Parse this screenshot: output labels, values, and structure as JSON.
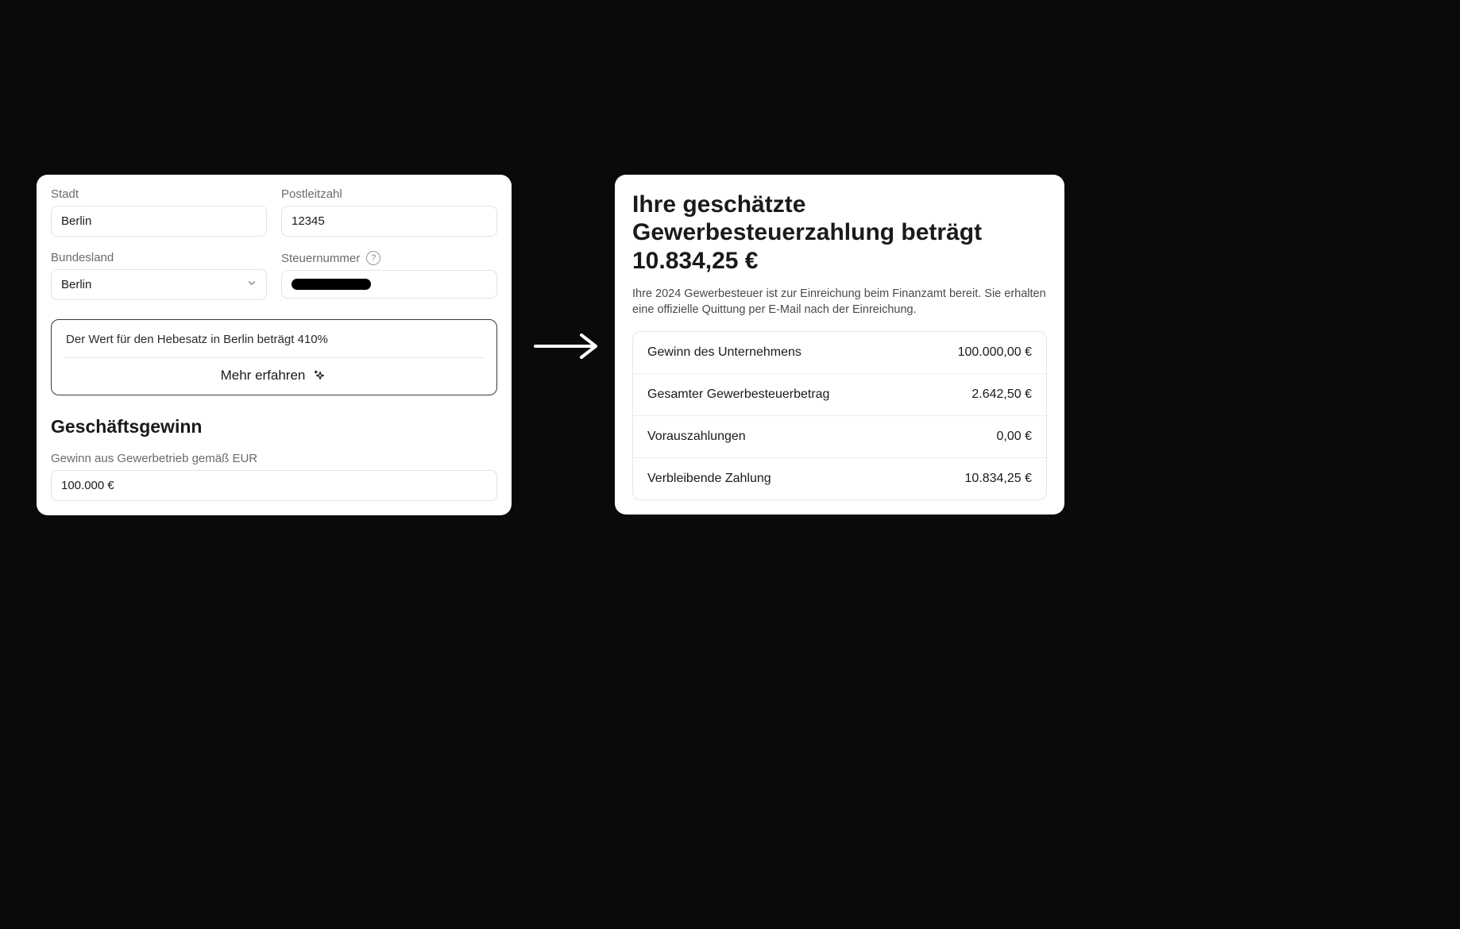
{
  "form": {
    "city": {
      "label": "Stadt",
      "value": "Berlin"
    },
    "postal": {
      "label": "Postleitzahl",
      "value": "12345"
    },
    "state": {
      "label": "Bundesland",
      "value": "Berlin"
    },
    "taxnum": {
      "label": "Steuernummer",
      "value": ""
    },
    "info": {
      "text": "Der Wert für den Hebesatz in Berlin beträgt 410%",
      "learn_more": "Mehr erfahren"
    },
    "profit": {
      "section_title": "Geschäftsgewinn",
      "label": "Gewinn aus Gewerbetrieb gemäß EUR",
      "value": "100.000 €"
    }
  },
  "result": {
    "title": "Ihre geschätzte Gewerbesteuerzahlung beträgt 10.834,25 €",
    "description": "Ihre 2024 Gewerbesteuer ist zur Einreichung beim Finanzamt bereit. Sie erhalten eine offizielle Quittung per E-Mail nach der Einreichung.",
    "rows": [
      {
        "label": "Gewinn des Unternehmens",
        "value": "100.000,00 €"
      },
      {
        "label": "Gesamter Gewerbesteuerbetrag",
        "value": "2.642,50 €"
      },
      {
        "label": "Vorauszahlungen",
        "value": "0,00 €"
      },
      {
        "label": "Verbleibende Zahlung",
        "value": "10.834,25 €"
      }
    ]
  }
}
